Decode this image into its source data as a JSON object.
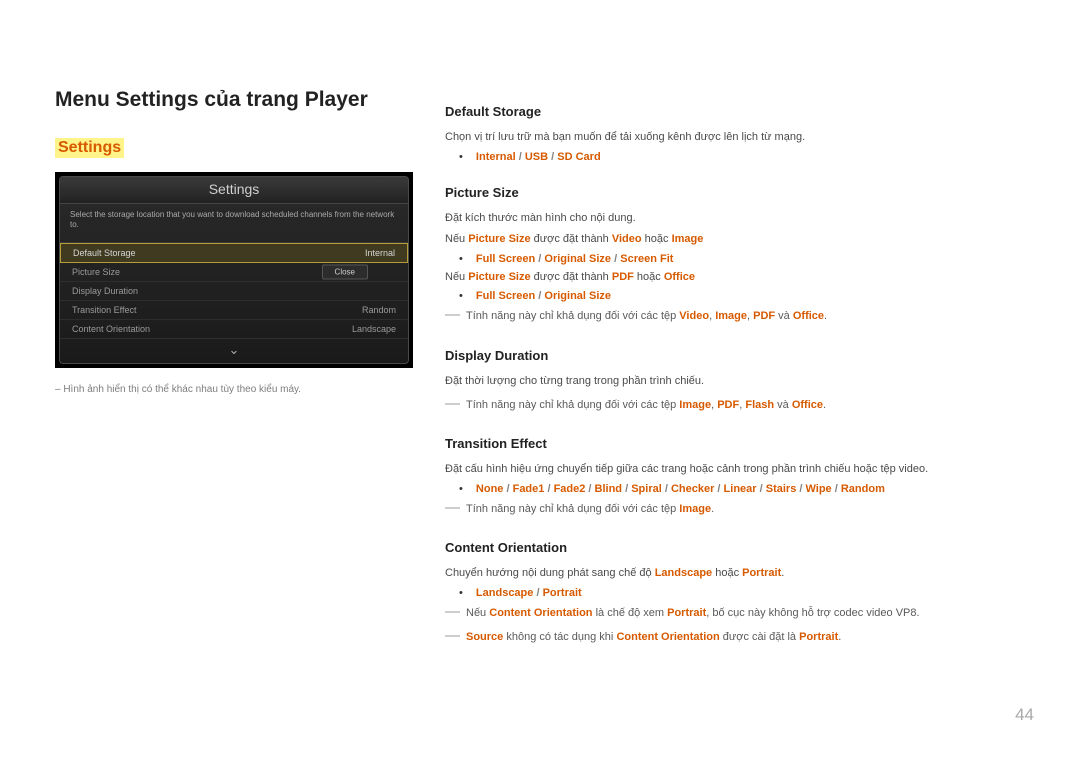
{
  "page": {
    "title": "Menu Settings của trang Player",
    "section_label": "Settings",
    "number": "44"
  },
  "image_note": "– Hình ảnh hiển thị có thể khác nhau tùy theo kiểu máy.",
  "device": {
    "title": "Settings",
    "hint": "Select the storage location that you want to download scheduled channels from the network to.",
    "rows": {
      "r0": {
        "label": "Default Storage",
        "value": "Internal"
      },
      "r1": {
        "label": "Picture Size",
        "value": ""
      },
      "r2": {
        "label": "Display Duration",
        "value": ""
      },
      "r3": {
        "label": "Transition Effect",
        "value": "Random"
      },
      "r4": {
        "label": "Content Orientation",
        "value": "Landscape"
      }
    },
    "close": "Close",
    "chevron": "⌄"
  },
  "sections": {
    "default_storage": {
      "heading": "Default Storage",
      "p1": "Chọn vị trí lưu trữ mà bạn muốn để tải xuống kênh được lên lịch từ mạng.",
      "opts": {
        "o1": "Internal",
        "o2": "USB",
        "o3": "SD Card"
      }
    },
    "picture_size": {
      "heading": "Picture Size",
      "p1": "Đặt kích thước màn hình cho nội dung.",
      "line2_a": "Nếu ",
      "line2_kw1": "Picture Size",
      "line2_b": " được đặt thành ",
      "line2_kw2": "Video",
      "line2_c": " hoặc ",
      "line2_kw3": "Image",
      "opts1": {
        "o1": "Full Screen",
        "o2": "Original Size",
        "o3": "Screen Fit"
      },
      "line3_a": "Nếu ",
      "line3_kw1": "Picture Size",
      "line3_b": " được đặt thành ",
      "line3_kw2": "PDF",
      "line3_c": " hoặc ",
      "line3_kw3": "Office",
      "opts2": {
        "o1": "Full Screen",
        "o2": "Original Size"
      },
      "note1_a": "Tính năng này chỉ khả dụng đối với các tệp ",
      "note1_kw1": "Video",
      "note1_s1": ", ",
      "note1_kw2": "Image",
      "note1_s2": ", ",
      "note1_kw3": "PDF",
      "note1_s3": " và ",
      "note1_kw4": "Office",
      "note1_end": "."
    },
    "display_duration": {
      "heading": "Display Duration",
      "p1": "Đặt thời lượng cho từng trang trong phần trình chiếu.",
      "note1_a": "Tính năng này chỉ khả dụng đối với các tệp ",
      "note1_kw1": "Image",
      "note1_s1": ", ",
      "note1_kw2": "PDF",
      "note1_s2": ", ",
      "note1_kw3": "Flash",
      "note1_s3": " và ",
      "note1_kw4": "Office",
      "note1_end": "."
    },
    "transition_effect": {
      "heading": "Transition Effect",
      "p1": "Đặt cấu hình hiệu ứng chuyển tiếp giữa các trang hoặc cảnh trong phần trình chiếu hoặc tệp video.",
      "opts": {
        "o1": "None",
        "o2": "Fade1",
        "o3": "Fade2",
        "o4": "Blind",
        "o5": "Spiral",
        "o6": "Checker",
        "o7": "Linear",
        "o8": "Stairs",
        "o9": "Wipe",
        "o10": "Random"
      },
      "note1_a": "Tính năng này chỉ khả dụng đối với các tệp ",
      "note1_kw1": "Image",
      "note1_end": "."
    },
    "content_orientation": {
      "heading": "Content Orientation",
      "p1_a": "Chuyển hướng nội dung phát sang chế độ ",
      "p1_kw1": "Landscape",
      "p1_b": " hoặc ",
      "p1_kw2": "Portrait",
      "p1_end": ".",
      "opts": {
        "o1": "Landscape",
        "o2": "Portrait"
      },
      "note1_a": "Nếu ",
      "note1_kw1": "Content Orientation",
      "note1_b": " là chế độ xem ",
      "note1_kw2": "Portrait",
      "note1_c": ", bố cục này không hỗ trợ codec video VP8.",
      "note2_kw1": "Source",
      "note2_a": " không có tác dụng khi ",
      "note2_kw2": "Content Orientation",
      "note2_b": " được cài đặt là ",
      "note2_kw3": "Portrait",
      "note2_end": "."
    }
  },
  "slash": " / "
}
